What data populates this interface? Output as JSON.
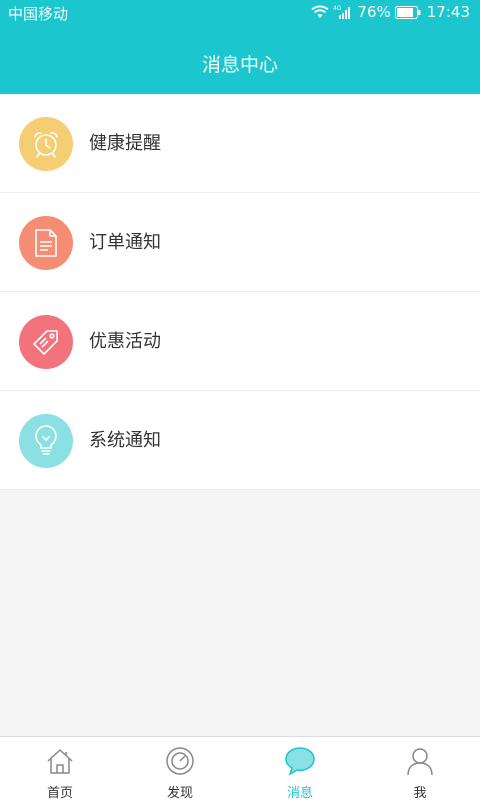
{
  "status_bar": {
    "carrier": "中国移动",
    "network": "4G",
    "battery": "76%",
    "time": "17:43"
  },
  "header": {
    "title": "消息中心"
  },
  "message_categories": [
    {
      "label": "健康提醒",
      "icon": "alarm-clock-icon",
      "color": "#f5cd73"
    },
    {
      "label": "订单通知",
      "icon": "document-icon",
      "color": "#f58d75"
    },
    {
      "label": "优惠活动",
      "icon": "price-tag-icon",
      "color": "#f2737c"
    },
    {
      "label": "系统通知",
      "icon": "lightbulb-icon",
      "color": "#8ae0e2"
    }
  ],
  "tabbar": {
    "tabs": [
      {
        "label": "首页",
        "icon": "home-icon"
      },
      {
        "label": "发现",
        "icon": "compass-icon"
      },
      {
        "label": "消息",
        "icon": "chat-bubble-icon",
        "active": true
      },
      {
        "label": "我",
        "icon": "user-icon"
      }
    ]
  },
  "colors": {
    "accent": "#1bc6cf"
  }
}
